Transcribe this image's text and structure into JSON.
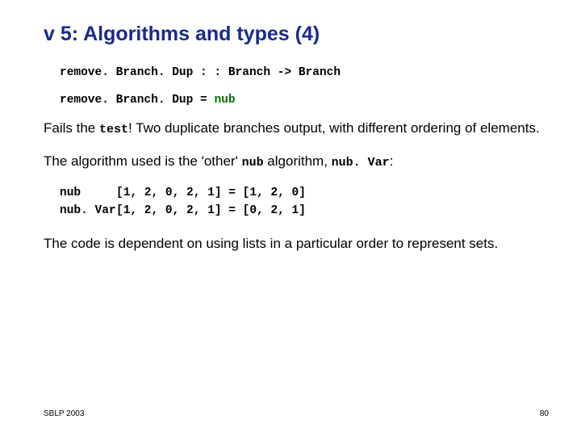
{
  "title": "v 5: Algorithms and types (4)",
  "code": {
    "sig_lhs": "remove. Branch. Dup : : Branch -> Branch",
    "def_lhs": "remove. Branch. Dup = ",
    "def_rhs": "nub"
  },
  "para1_pre": "Fails the ",
  "para1_mono": "test",
  "para1_post": "! Two duplicate branches output, with different ordering of elements.",
  "para2_pre": "The algorithm used is the 'other' ",
  "para2_mono1": "nub",
  "para2_mid": " algorithm, ",
  "para2_mono2": "nub. Var",
  "para2_post": ":",
  "eq1_fn": "nub",
  "eq1_arg": "[1, 2, 0, 2, 1] = [1, 2, 0]",
  "eq2_fn": "nub. Var",
  "eq2_arg": "[1, 2, 0, 2, 1] = [0, 2, 1]",
  "para3": "The code is dependent on using lists in a particular order to represent sets.",
  "footer_left": "SBLP 2003",
  "footer_right": "80"
}
